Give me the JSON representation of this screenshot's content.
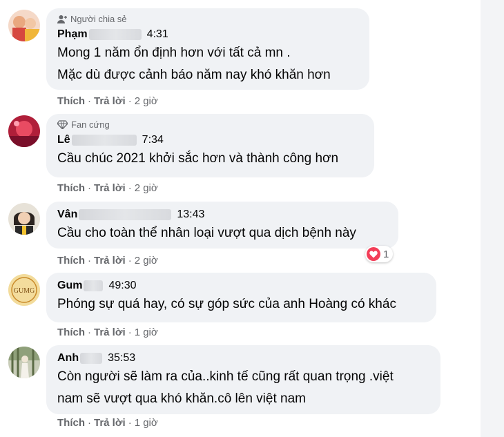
{
  "colors": {
    "bubble_bg": "#f0f2f5",
    "meta_text": "#65676b",
    "heart": "#f33e58"
  },
  "comments": [
    {
      "badge": "Người chia sẻ",
      "badge_icon": "person-share-icon",
      "name": "Phạm",
      "time": "4:31",
      "text": "Mong 1 năm ổn định hơn với tất cả mn .\nMặc dù được cảnh báo năm nay khó khăn hơn",
      "like": "Thích",
      "reply": "Trả lời",
      "age": "2 giờ"
    },
    {
      "badge": "Fan cứng",
      "badge_icon": "diamond-icon",
      "name": "Lê",
      "time": "7:34",
      "text": "Cầu chúc 2021 khởi sắc hơn và thành công hơn",
      "like": "Thích",
      "reply": "Trả lời",
      "age": "2 giờ"
    },
    {
      "name": "Vân",
      "time": "13:43",
      "text": "Cầu cho toàn thể nhân loại vượt qua dịch bệnh này",
      "reaction_icon": "heart-icon",
      "reaction_count": "1",
      "like": "Thích",
      "reply": "Trả lời",
      "age": "2 giờ"
    },
    {
      "name": "Gum",
      "time": "49:30",
      "text": "Phóng sự quá hay, có sự góp sức của anh Hoàng có khác",
      "avatar_text": "GUMG",
      "like": "Thích",
      "reply": "Trả lời",
      "age": "1 giờ"
    },
    {
      "name": "Anh",
      "time": "35:53",
      "text": "Còn người sẽ làm ra của..kinh tế cũng rất quan trọng .việt\nnam sẽ vượt qua khó khăn.cô lên việt nam",
      "like": "Thích",
      "reply": "Trả lời",
      "age": "1 giờ"
    }
  ]
}
